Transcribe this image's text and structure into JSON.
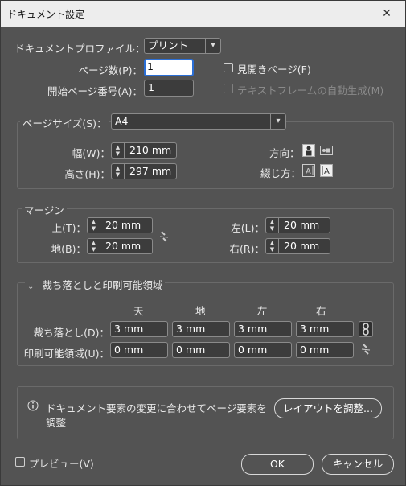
{
  "window": {
    "title": "ドキュメント設定",
    "close_glyph": "✕"
  },
  "profile": {
    "label": "ドキュメントプロファイル：",
    "value": "プリント"
  },
  "pages": {
    "label": "ページ数(P)：",
    "value": "1",
    "facing_label": "見開きページ(F)"
  },
  "start_page": {
    "label": "開始ページ番号(A)：",
    "value": "1",
    "text_frame_label": "テキストフレームの自動生成(M)"
  },
  "page_size": {
    "label": "ページサイズ(S)：",
    "value": "A4",
    "width_label": "幅(W)：",
    "width": "210 mm",
    "height_label": "高さ(H)：",
    "height": "297 mm",
    "orientation_label": "方向：",
    "binding_label": "綴じ方："
  },
  "margins": {
    "title": "マージン",
    "top_label": "上(T)：",
    "top": "20 mm",
    "bottom_label": "地(B)：",
    "bottom": "20 mm",
    "left_label": "左(L)：",
    "left": "20 mm",
    "right_label": "右(R)：",
    "right": "20 mm"
  },
  "bleed": {
    "title": "裁ち落としと印刷可能領域",
    "col_top": "天",
    "col_bottom": "地",
    "col_left": "左",
    "col_right": "右",
    "bleed_label": "裁ち落とし(D)：",
    "bleed_values": [
      "3 mm",
      "3 mm",
      "3 mm",
      "3 mm"
    ],
    "slug_label": "印刷可能領域(U)：",
    "slug_values": [
      "0 mm",
      "0 mm",
      "0 mm",
      "0 mm"
    ]
  },
  "info": {
    "line1": "ドキュメント要素の変更に合わせてページ要素を",
    "line2": "調整",
    "button": "レイアウトを調整..."
  },
  "footer": {
    "preview": "プレビュー(V)",
    "ok": "OK",
    "cancel": "キャンセル"
  }
}
